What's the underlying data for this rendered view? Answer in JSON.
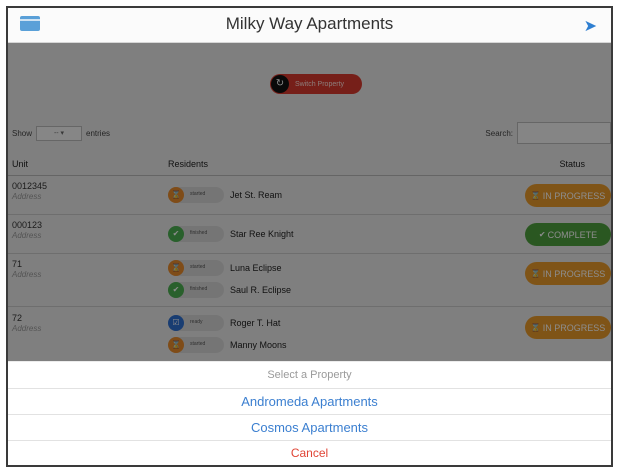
{
  "header": {
    "title": "Milky Way Apartments",
    "menu_icon": "menu-icon",
    "exit_icon": "sign-out-icon"
  },
  "switch_property": {
    "label": "Switch Property",
    "icon": "refresh-icon"
  },
  "table_controls": {
    "show_label": "Show",
    "entries_select": "--",
    "entries_label": "entries",
    "search_label": "Search:"
  },
  "table": {
    "columns": {
      "unit": "Unit",
      "residents": "Residents",
      "status": "Status"
    },
    "rows": [
      {
        "unit": "0012345",
        "address": "Address",
        "residents": [
          {
            "state": "started",
            "name": "Jet St. Ream"
          }
        ],
        "status": "IN PROGRESS"
      },
      {
        "unit": "000123",
        "address": "Address",
        "residents": [
          {
            "state": "finished",
            "name": "Star Ree Knight"
          }
        ],
        "status": "COMPLETE"
      },
      {
        "unit": "71",
        "address": "Address",
        "residents": [
          {
            "state": "started",
            "name": "Luna Eclipse"
          },
          {
            "state": "finished",
            "name": "Saul R. Eclipse"
          }
        ],
        "status": "IN PROGRESS"
      },
      {
        "unit": "72",
        "address": "Address",
        "residents": [
          {
            "state": "ready",
            "name": "Roger T. Hat"
          },
          {
            "state": "started",
            "name": "Manny Moons"
          }
        ],
        "status": "IN PROGRESS"
      }
    ]
  },
  "action_sheet": {
    "title": "Select a Property",
    "options": [
      "Andromeda Apartments",
      "Cosmos Apartments"
    ],
    "cancel": "Cancel"
  },
  "colors": {
    "started": "#e88b2c",
    "finished": "#4caf50",
    "ready": "#2f6fd0",
    "in_progress": "#e89a2a",
    "complete": "#4e9f3d",
    "switch_button": "#d83a2e",
    "accent_blue": "#3b7fd0",
    "cancel_red": "#e04536"
  }
}
